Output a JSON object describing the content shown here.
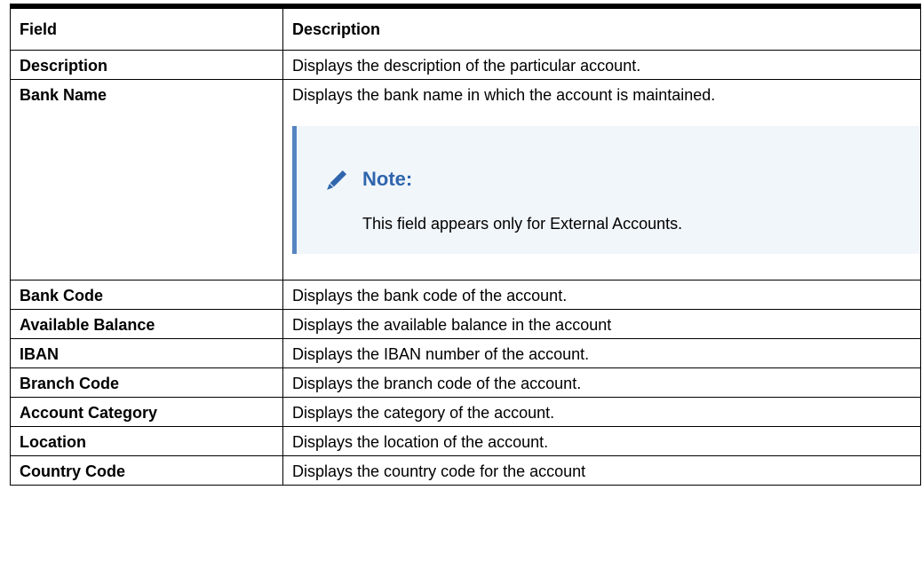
{
  "table": {
    "headers": {
      "field": "Field",
      "description": "Description"
    },
    "rows": [
      {
        "field": "Description",
        "description": "Displays the description of the particular account."
      },
      {
        "field": "Bank Name",
        "description": "Displays the bank name in which the account is maintained."
      },
      {
        "field": "Bank Code",
        "description": "Displays the bank code of the account."
      },
      {
        "field": "Available Balance",
        "description": "Displays the available balance in the account"
      },
      {
        "field": "IBAN",
        "description": "Displays the IBAN number of the account."
      },
      {
        "field": "Branch Code",
        "description": "Displays the branch code of the account."
      },
      {
        "field": "Account Category",
        "description": "Displays the category of the account."
      },
      {
        "field": "Location",
        "description": "Displays the location of the account."
      },
      {
        "field": "Country Code",
        "description": "Displays the country code for the account"
      }
    ]
  },
  "note": {
    "icon": "pencil-icon",
    "title": "Note:",
    "body": "This field appears only for External Accounts."
  },
  "colors": {
    "note_background": "#f1f6fb",
    "note_accent": "#5684c1",
    "note_title": "#2f65ad"
  }
}
